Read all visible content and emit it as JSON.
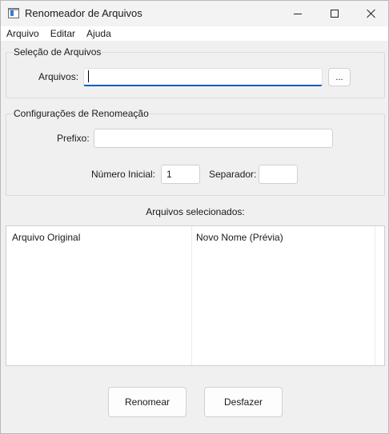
{
  "window": {
    "title": "Renomeador de Arquivos"
  },
  "menu": {
    "items": [
      "Arquivo",
      "Editar",
      "Ajuda"
    ]
  },
  "selection_group": {
    "label": "Seleção de Arquivos",
    "files_label": "Arquivos:",
    "files_value": "",
    "browse_label": "..."
  },
  "config_group": {
    "label": "Configurações de Renomeação",
    "prefix_label": "Prefixo:",
    "prefix_value": "",
    "start_number_label": "Número Inicial:",
    "start_number_value": "1",
    "separator_label": "Separador:",
    "separator_value": ""
  },
  "file_list": {
    "caption": "Arquivos selecionados:",
    "columns": [
      "Arquivo Original",
      "Novo Nome (Prévia)"
    ],
    "rows": []
  },
  "actions": {
    "rename_label": "Renomear",
    "undo_label": "Desfazer"
  },
  "colors": {
    "accent": "#005fb8",
    "window_bg": "#f0f0f0"
  }
}
